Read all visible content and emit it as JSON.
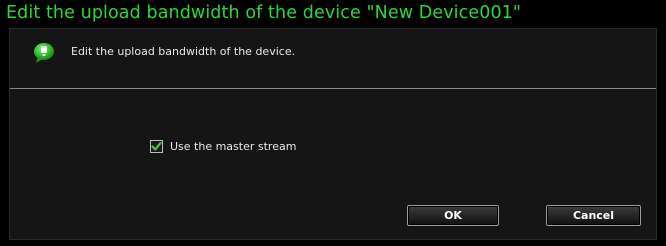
{
  "dialog": {
    "title": "Edit the upload bandwidth of the device \"New Device001\"",
    "header_text": "Edit the upload bandwidth of the device.",
    "header_icon": "info-bubble-icon",
    "master_stream": {
      "label": "Use the master stream",
      "checked": true
    },
    "buttons": {
      "ok_label": "OK",
      "cancel_label": "Cancel"
    }
  },
  "colors": {
    "title": "#2ad83a",
    "background": "#000000",
    "panel": "#151515",
    "icon_green": "#33c433",
    "checkbox_check": "#3ccf3c"
  }
}
